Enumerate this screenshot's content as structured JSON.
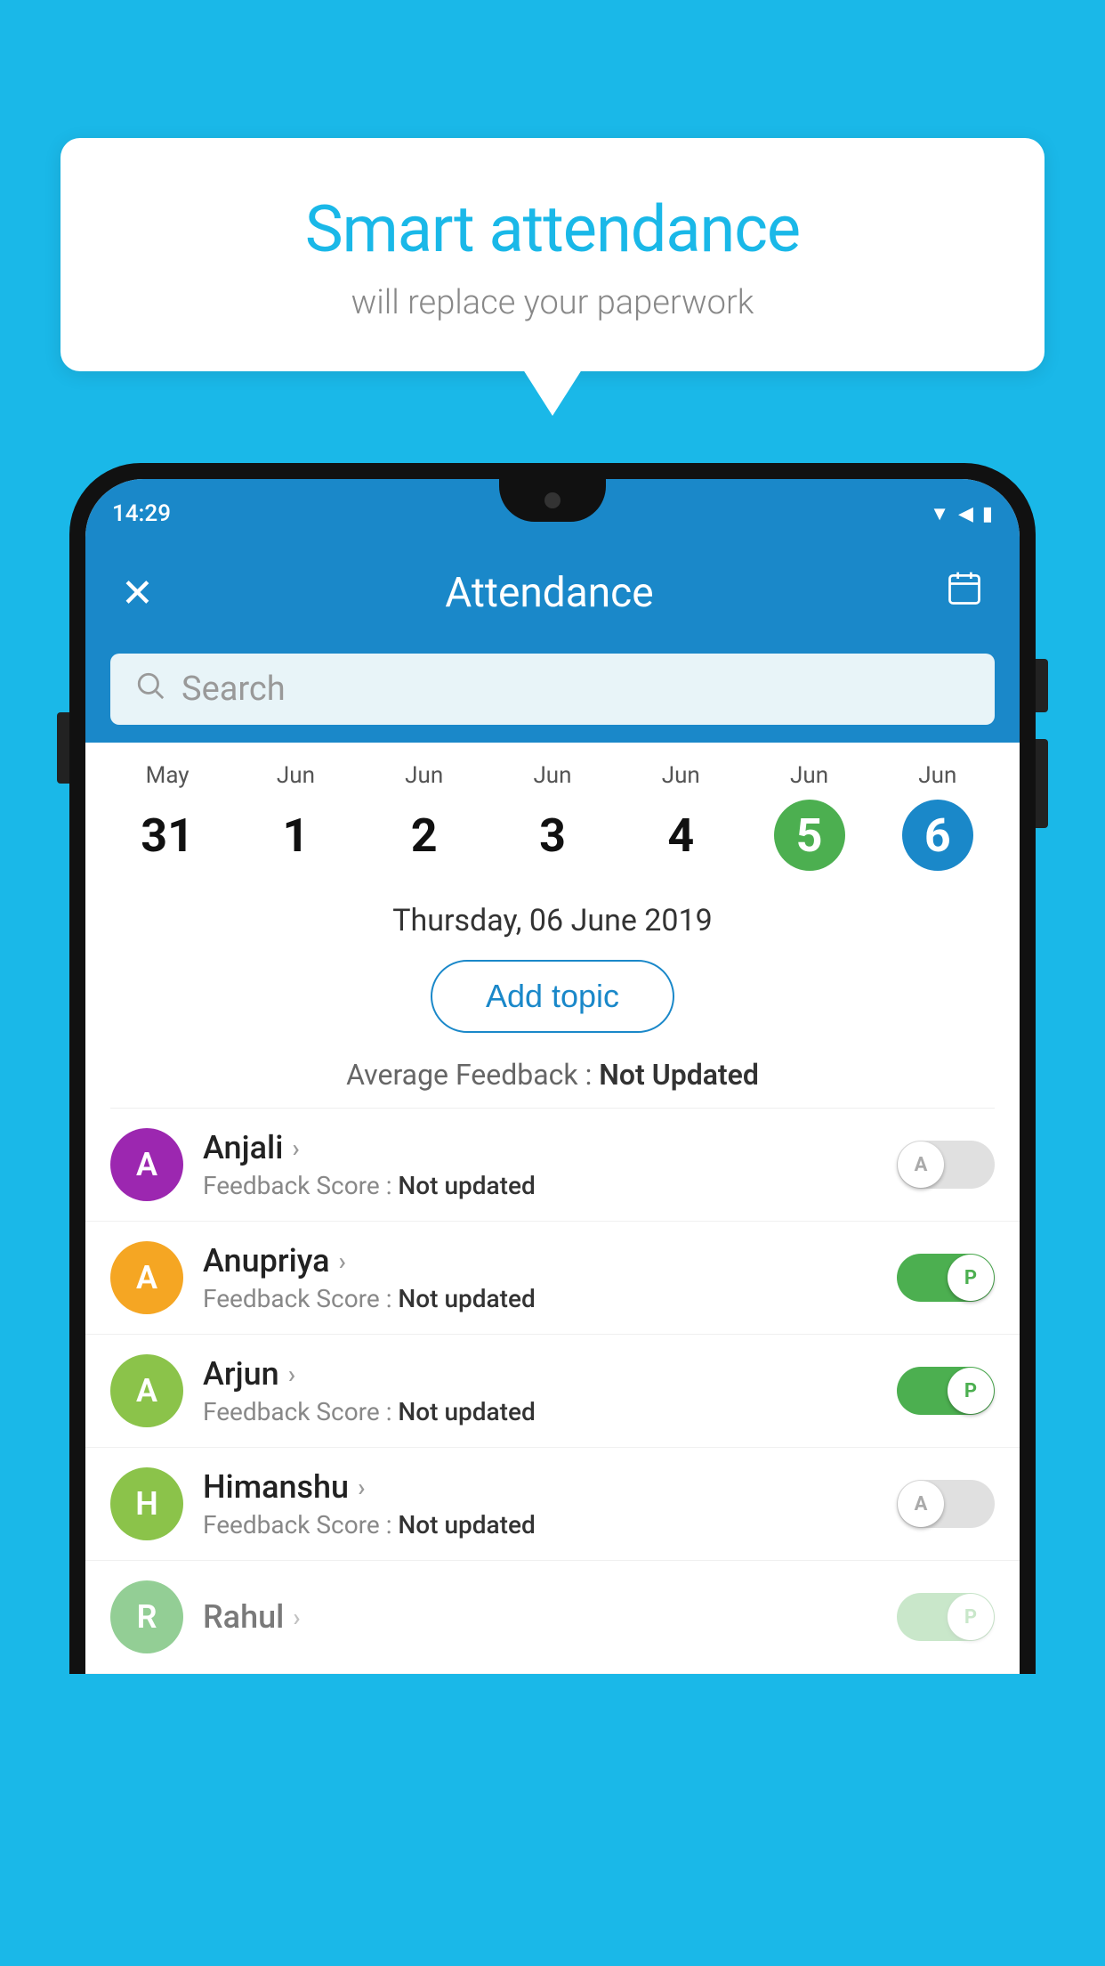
{
  "background_color": "#1ab8e8",
  "bubble": {
    "title": "Smart attendance",
    "subtitle": "will replace your paperwork"
  },
  "status_bar": {
    "time": "14:29",
    "icons": [
      "▼",
      "◀",
      "▮"
    ]
  },
  "header": {
    "close_icon": "✕",
    "title": "Attendance",
    "calendar_icon": "📅"
  },
  "search": {
    "placeholder": "Search"
  },
  "calendar": {
    "days": [
      {
        "month": "May",
        "num": "31",
        "state": "normal"
      },
      {
        "month": "Jun",
        "num": "1",
        "state": "normal"
      },
      {
        "month": "Jun",
        "num": "2",
        "state": "normal"
      },
      {
        "month": "Jun",
        "num": "3",
        "state": "normal"
      },
      {
        "month": "Jun",
        "num": "4",
        "state": "normal"
      },
      {
        "month": "Jun",
        "num": "5",
        "state": "today"
      },
      {
        "month": "Jun",
        "num": "6",
        "state": "selected"
      }
    ]
  },
  "selected_date": "Thursday, 06 June 2019",
  "add_topic_label": "Add topic",
  "average_feedback": {
    "label": "Average Feedback : ",
    "value": "Not Updated"
  },
  "students": [
    {
      "name": "Anjali",
      "avatar_letter": "A",
      "avatar_color": "#9c27b0",
      "score_label": "Feedback Score : ",
      "score_value": "Not updated",
      "toggle_state": "off",
      "toggle_label": "A"
    },
    {
      "name": "Anupriya",
      "avatar_letter": "A",
      "avatar_color": "#f5a623",
      "score_label": "Feedback Score : ",
      "score_value": "Not updated",
      "toggle_state": "on",
      "toggle_label": "P"
    },
    {
      "name": "Arjun",
      "avatar_letter": "A",
      "avatar_color": "#8bc34a",
      "score_label": "Feedback Score : ",
      "score_value": "Not updated",
      "toggle_state": "on",
      "toggle_label": "P"
    },
    {
      "name": "Himanshu",
      "avatar_letter": "H",
      "avatar_color": "#8bc34a",
      "score_label": "Feedback Score : ",
      "score_value": "Not updated",
      "toggle_state": "off",
      "toggle_label": "A"
    }
  ]
}
